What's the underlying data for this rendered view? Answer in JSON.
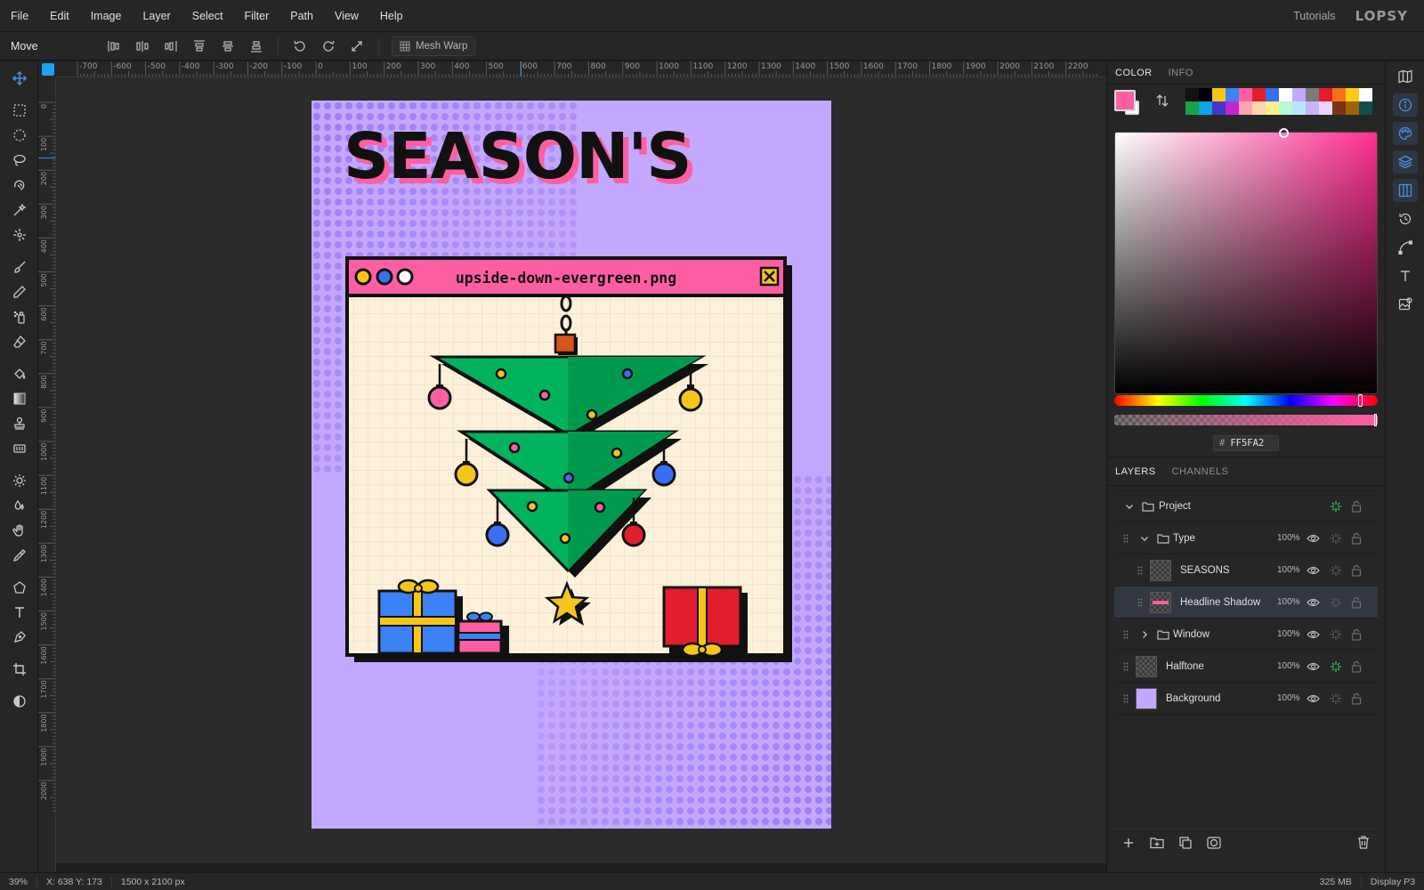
{
  "menubar": {
    "items": [
      "File",
      "Edit",
      "Image",
      "Layer",
      "Select",
      "Filter",
      "Path",
      "View",
      "Help"
    ],
    "tutorials": "Tutorials",
    "logo": "LOPSY"
  },
  "options": {
    "tool_name": "Move",
    "mesh_warp": "Mesh Warp"
  },
  "rulers": {
    "horizontal": [
      "-700",
      "-600",
      "-500",
      "-400",
      "-300",
      "-200",
      "-100",
      "0",
      "100",
      "200",
      "300",
      "400",
      "500",
      "600",
      "700",
      "800",
      "900",
      "1000",
      "1100",
      "1200",
      "1300",
      "1400",
      "1500",
      "1600",
      "1700",
      "1800",
      "1900",
      "2000",
      "2100",
      "2200"
    ],
    "vertical": [
      "0",
      "100",
      "200",
      "300",
      "400",
      "500",
      "600",
      "700",
      "800",
      "900",
      "1000",
      "1100",
      "1200",
      "1300",
      "1400",
      "1500",
      "1600",
      "1700",
      "1800",
      "1900",
      "2000"
    ]
  },
  "artwork": {
    "headline": "SEASON'S",
    "window_title": "upside-down-evergreen.png",
    "colors": {
      "background": "#c4a8ff",
      "halftone": "#9c7bf5",
      "pink": "#ff5fa2",
      "green": "#00b35c",
      "cream": "#fdf1dc"
    }
  },
  "color_panel": {
    "tabs": [
      "COLOR",
      "INFO"
    ],
    "hex": "FF5FA2",
    "hash": "#",
    "foreground": "#ff5fa2",
    "palette": [
      "#111111",
      "#000000",
      "#f5c518",
      "#3b82f6",
      "#ff5fa2",
      "#e11d2e",
      "#3b6ef6",
      "#ffffff",
      "#c4a8ff",
      "#7a7a7a",
      "#e11d2e",
      "#f97316",
      "#facc15",
      "#ffffff",
      "#16a34a",
      "#0ea5e9",
      "#4338ca",
      "#c026d3",
      "#fda4af",
      "#fed7aa",
      "#fef08a",
      "#bbf7d0",
      "#bae6fd",
      "#c4b5fd",
      "#e9d5ff",
      "#78350f",
      "#a16207",
      "#134e4a"
    ]
  },
  "layers_panel": {
    "tabs": [
      "LAYERS",
      "CHANNELS"
    ],
    "layers": [
      {
        "name": "Project",
        "opacity": ""
      },
      {
        "name": "Type",
        "opacity": "100%"
      },
      {
        "name": "SEASONS",
        "opacity": "100%"
      },
      {
        "name": "Headline Shadow",
        "opacity": "100%"
      },
      {
        "name": "Window",
        "opacity": "100%"
      },
      {
        "name": "Halftone",
        "opacity": "100%"
      },
      {
        "name": "Background",
        "opacity": "100%"
      }
    ]
  },
  "status": {
    "zoom": "39%",
    "coords": "X: 638 Y: 173",
    "dims": "1500 x 2100 px",
    "memory": "325 MB",
    "profile": "Display P3"
  }
}
